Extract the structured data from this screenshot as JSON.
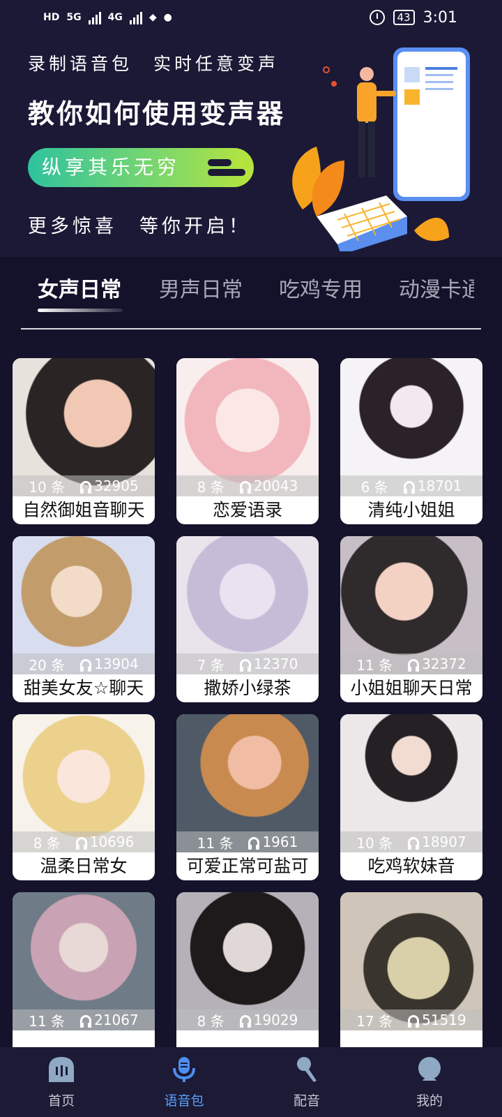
{
  "status_bar": {
    "left_indicators": [
      "HD",
      "5G",
      "4G"
    ],
    "battery": "43",
    "time": "3:01"
  },
  "banner": {
    "line1": "录制语音包　实时任意变声",
    "title": "教你如何使用变声器",
    "pill": "纵享其乐无穷",
    "line3": "更多惊喜　等你开启！"
  },
  "tabs": [
    {
      "label": "女声日常",
      "active": true
    },
    {
      "label": "男声日常",
      "active": false
    },
    {
      "label": "吃鸡专用",
      "active": false
    },
    {
      "label": "动漫卡通",
      "active": false
    }
  ],
  "cards": [
    {
      "count": "10 条",
      "plays": "32905",
      "name": "自然御姐音聊天"
    },
    {
      "count": "8 条",
      "plays": "20043",
      "name": "恋爱语录"
    },
    {
      "count": "6 条",
      "plays": "18701",
      "name": "清纯小姐姐"
    },
    {
      "count": "20 条",
      "plays": "13904",
      "name": "甜美女友☆聊天"
    },
    {
      "count": "7 条",
      "plays": "12370",
      "name": "撒娇小绿茶"
    },
    {
      "count": "11 条",
      "plays": "32372",
      "name": "小姐姐聊天日常"
    },
    {
      "count": "8 条",
      "plays": "10696",
      "name": "温柔日常女"
    },
    {
      "count": "11 条",
      "plays": "1961",
      "name": "可爱正常可盐可"
    },
    {
      "count": "10 条",
      "plays": "18907",
      "name": "吃鸡软妹音"
    },
    {
      "count": "11 条",
      "plays": "21067",
      "name": ""
    },
    {
      "count": "8 条",
      "plays": "19029",
      "name": ""
    },
    {
      "count": "17 条",
      "plays": "51519",
      "name": ""
    }
  ],
  "bottom_nav": [
    {
      "label": "首页",
      "icon": "home-icon",
      "active": false
    },
    {
      "label": "语音包",
      "icon": "microphone-icon",
      "active": true
    },
    {
      "label": "配音",
      "icon": "handheld-mic-icon",
      "active": false
    },
    {
      "label": "我的",
      "icon": "profile-icon",
      "active": false
    }
  ],
  "colors": {
    "background": "#15132b",
    "accent": "#5aa0ff",
    "pill_start": "#2fc29e",
    "pill_end": "#b8e43c"
  }
}
